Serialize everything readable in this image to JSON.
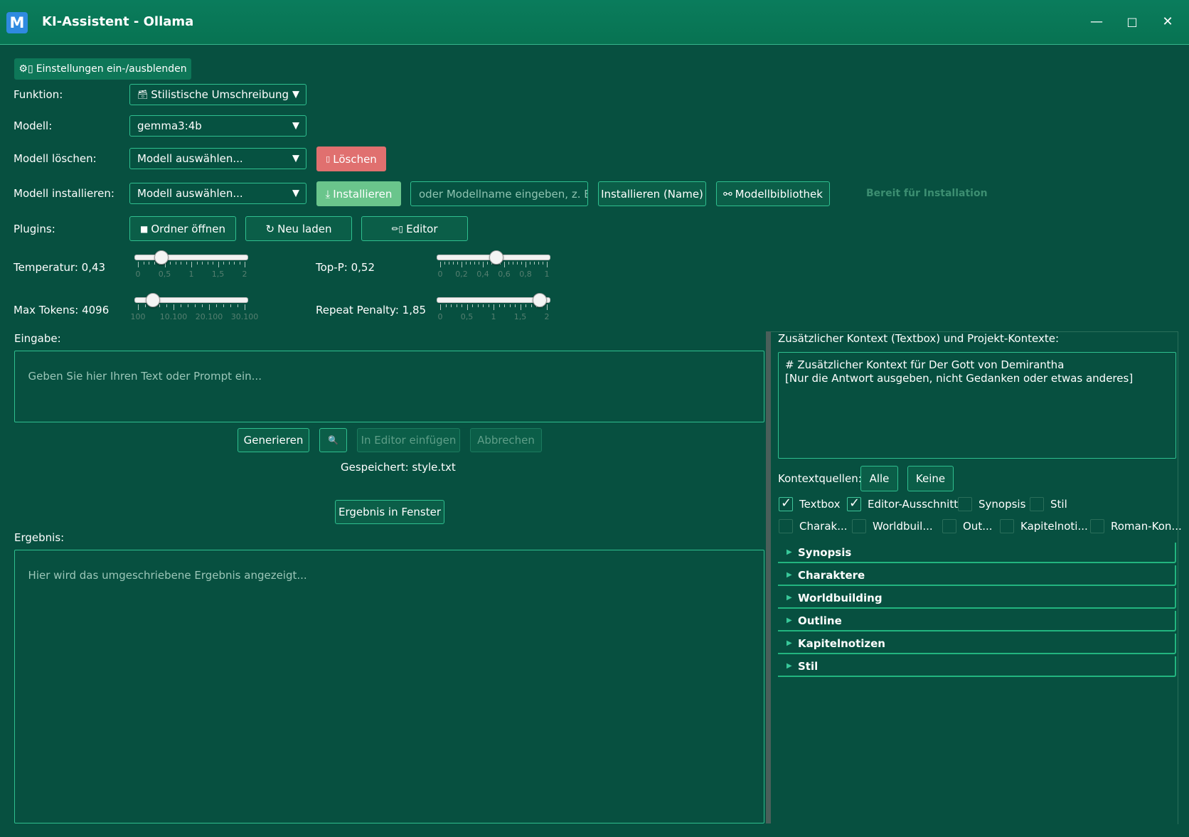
{
  "window": {
    "title": "KI-Assistent - Ollama",
    "app_icon_letter": "M",
    "minimize": "—",
    "maximize": "□",
    "close": "✕"
  },
  "toggle_settings": {
    "icon": "⚙▯",
    "label": "Einstellungen ein-/ausblenden"
  },
  "funktion": {
    "label": "Funktion:",
    "value": "Stilistische Umschreibung",
    "icon": "🗃"
  },
  "modell": {
    "label": "Modell:",
    "value": "gemma3:4b"
  },
  "modell_loeschen": {
    "label": "Modell löschen:",
    "value": "Modell auswählen...",
    "button": "Löschen",
    "button_icon": "▯"
  },
  "modell_installieren": {
    "label": "Modell installieren:",
    "value": "Modell auswählen...",
    "install_button": "Installieren",
    "install_icon": "⤓",
    "name_placeholder": "oder Modellname eingeben, z. B. ll",
    "install_name_button": "Installieren (Name)",
    "library_button": "Modellbibliothek",
    "library_icon": "⚯",
    "status": "Bereit für Installation"
  },
  "plugins": {
    "label": "Plugins:",
    "open_folder": "Ordner öffnen",
    "open_folder_icon": "■",
    "reload": "Neu laden",
    "reload_icon": "↻",
    "editor": "Editor",
    "editor_icon": "✏▯"
  },
  "sliders": {
    "temperature": {
      "label": "Temperatur: 0,43",
      "value": 0.43,
      "min": 0,
      "max": 2,
      "ticks": [
        "0",
        "0,5",
        "1",
        "1,5",
        "2"
      ]
    },
    "top_p": {
      "label": "Top-P: 0,52",
      "value": 0.52,
      "min": 0,
      "max": 1,
      "ticks": [
        "0",
        "0,2",
        "0,4",
        "0,6",
        "0,8",
        "1"
      ]
    },
    "max_tokens": {
      "label": "Max Tokens: 4096",
      "value": 4096,
      "min": 100,
      "max": 30100,
      "ticks": [
        "100",
        "10.100",
        "20.100",
        "30.100"
      ]
    },
    "repeat_penalty": {
      "label": "Repeat Penalty: 1,85",
      "value": 1.85,
      "min": 0,
      "max": 2,
      "ticks": [
        "0",
        "0,5",
        "1",
        "1,5",
        "2"
      ]
    }
  },
  "input": {
    "label": "Eingabe:",
    "placeholder": "Geben Sie hier Ihren Text oder Prompt ein..."
  },
  "actions": {
    "generate": "Generieren",
    "search_icon": "🔍",
    "insert_editor": "In Editor einfügen",
    "cancel": "Abbrechen",
    "saved_status": "Gespeichert: style.txt",
    "result_window": "Ergebnis in Fenster"
  },
  "result": {
    "label": "Ergebnis:",
    "placeholder": "Hier wird das umgeschriebene Ergebnis angezeigt..."
  },
  "context": {
    "label": "Zusätzlicher Kontext (Textbox) und Projekt-Kontexte:",
    "text": "# Zusätzlicher Kontext für Der Gott von Demirantha\n[Nur die Antwort ausgeben, nicht Gedanken oder etwas anderes]",
    "sources_label": "Kontextquellen:",
    "all_button": "Alle",
    "none_button": "Keine",
    "checkboxes": [
      {
        "label": "Textbox",
        "checked": true
      },
      {
        "label": "Editor-Ausschnitt",
        "checked": true
      },
      {
        "label": "Synopsis",
        "checked": false
      },
      {
        "label": "Stil",
        "checked": false
      },
      {
        "label": "Charak...",
        "checked": false
      },
      {
        "label": "Worldbuil...",
        "checked": false
      },
      {
        "label": "Out...",
        "checked": false
      },
      {
        "label": "Kapitelnoti...",
        "checked": false
      },
      {
        "label": "Roman-Kon...",
        "checked": false
      }
    ],
    "sections": [
      "Synopsis",
      "Charaktere",
      "Worldbuilding",
      "Outline",
      "Kapitelnotizen",
      "Stil"
    ]
  },
  "colors": {
    "background": "#075040",
    "accent": "#2fbf8f",
    "delete": "#e0706f",
    "install": "#6ac58c",
    "titlebar": "#0a7c5c"
  }
}
